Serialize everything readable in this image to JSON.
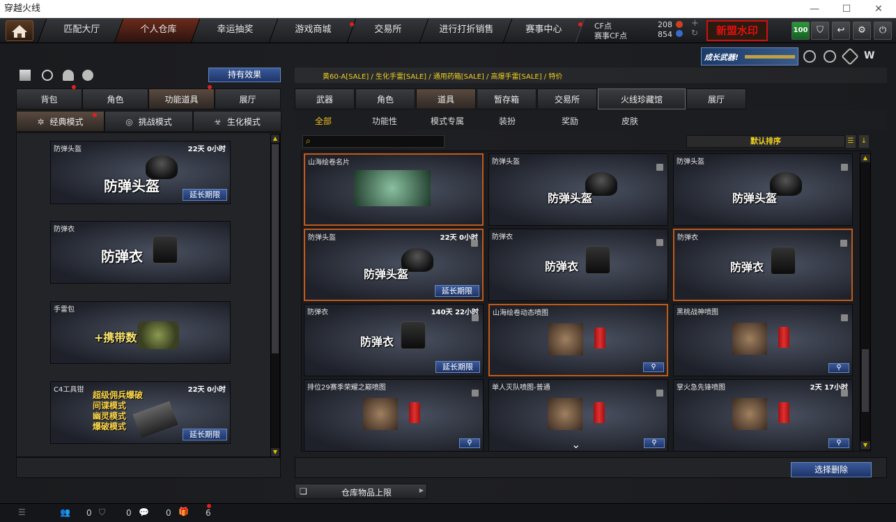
{
  "window": {
    "title": "穿越火线"
  },
  "nav": {
    "tabs": [
      "匹配大厅",
      "个人仓库",
      "幸运抽奖",
      "游戏商城",
      "交易所",
      "进行打折销售",
      "赛事中心"
    ]
  },
  "points": {
    "cf_label": "CF点",
    "cf_value": "208",
    "match_label": "赛事CF点",
    "match_value": "854"
  },
  "watermark": "新盟水印",
  "level": "100",
  "growth_banner": "成长武器!",
  "left": {
    "effect_button": "持有效果",
    "tabs": [
      "背包",
      "角色",
      "功能道具",
      "展厅"
    ],
    "modes": [
      "经典模式",
      "挑战模式",
      "生化模式"
    ],
    "items": [
      {
        "name": "防弹头盔",
        "time": "22天 0小时",
        "big": "防弹头盔",
        "extend": "延长期限"
      },
      {
        "name": "防弹衣",
        "time": "",
        "big": "防弹衣",
        "extend": ""
      },
      {
        "name": "手雷包",
        "time": "",
        "big": "+携带数",
        "extend": ""
      },
      {
        "name": "C4工具钳",
        "time": "22天 0小时",
        "lines": [
          "超级佣兵爆破",
          "间谍模式",
          "幽灵模式",
          "爆破模式"
        ],
        "extend": "延长期限"
      }
    ]
  },
  "right": {
    "marquee": "黄60-A[SALE] / 生化手雷[SALE] / 通用药箱[SALE] / 高爆手雷[SALE] / 特价",
    "tabs": [
      "武器",
      "角色",
      "道具",
      "暂存箱",
      "交易所",
      "火线珍藏馆",
      "展厅"
    ],
    "filters": [
      "全部",
      "功能性",
      "模式专属",
      "装扮",
      "奖励",
      "皮肤"
    ],
    "sort": "默认排序",
    "items": [
      {
        "name": "山海绘卷名片",
        "time": "",
        "big": "",
        "kind": "card",
        "extend": "",
        "hl": true
      },
      {
        "name": "防弹头盔",
        "time": "",
        "big": "防弹头盔",
        "kind": "helmet",
        "extend": "",
        "hl": false
      },
      {
        "name": "防弹头盔",
        "time": "",
        "big": "防弹头盔",
        "kind": "helmet",
        "extend": "",
        "hl": false
      },
      {
        "name": "防弹头盔",
        "time": "22天 0小时",
        "big": "防弹头盔",
        "kind": "helmet",
        "extend": "延长期限",
        "hl": true
      },
      {
        "name": "防弹衣",
        "time": "",
        "big": "防弹衣",
        "kind": "vest",
        "extend": "",
        "hl": false
      },
      {
        "name": "防弹衣",
        "time": "",
        "big": "防弹衣",
        "kind": "vest",
        "extend": "",
        "hl": true
      },
      {
        "name": "防弹衣",
        "time": "140天 22小时",
        "big": "防弹衣",
        "kind": "vest",
        "extend": "延长期限",
        "hl": false
      },
      {
        "name": "山海绘卷动态喷图",
        "time": "",
        "big": "",
        "kind": "spray",
        "extend": "",
        "hl": true
      },
      {
        "name": "黑桃战神喷图",
        "time": "",
        "big": "",
        "kind": "spray",
        "extend": "",
        "hl": false
      },
      {
        "name": "排位29赛季荣耀之巅喷图",
        "time": "",
        "big": "",
        "kind": "spray",
        "extend": "",
        "hl": false
      },
      {
        "name": "单人灭队喷图-普通",
        "time": "",
        "big": "",
        "kind": "spray",
        "extend": "",
        "hl": false
      },
      {
        "name": "掌火急先锋喷图",
        "time": "2天 17小时",
        "big": "",
        "kind": "spray",
        "extend": "",
        "hl": false
      }
    ],
    "delete_button": "选择删除",
    "storage_button": "仓库物品上限"
  },
  "bottom": {
    "counts": [
      "0",
      "0",
      "0",
      "6"
    ]
  }
}
